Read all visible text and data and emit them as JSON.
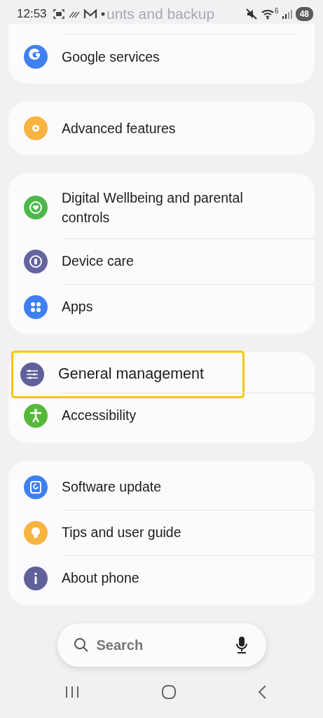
{
  "status_bar": {
    "time": "12:53",
    "wifi_band": "6",
    "battery": "48"
  },
  "faded_header": "unts and backup",
  "groups": [
    {
      "items": [
        {
          "label": "Google services",
          "color": "#3f7ff0",
          "highlighted": false
        }
      ]
    },
    {
      "items": [
        {
          "label": "Advanced features",
          "color": "#f7b43f",
          "highlighted": false
        }
      ]
    },
    {
      "items": [
        {
          "label": "Digital Wellbeing and parental controls",
          "color": "#4cb84a",
          "highlighted": false
        },
        {
          "label": "Device care",
          "color": "#6464a0",
          "highlighted": false
        },
        {
          "label": "Apps",
          "color": "#3f7ff0",
          "highlighted": false
        }
      ]
    },
    {
      "items": [
        {
          "label": "General management",
          "color": "#60609a",
          "highlighted": true
        },
        {
          "label": "Accessibility",
          "color": "#56b83a",
          "highlighted": false
        }
      ]
    },
    {
      "items": [
        {
          "label": "Software update",
          "color": "#3f7ff0",
          "highlighted": false
        },
        {
          "label": "Tips and user guide",
          "color": "#f7b43f",
          "highlighted": false
        },
        {
          "label": "About phone",
          "color": "#60609a",
          "highlighted": false
        }
      ]
    }
  ],
  "search": {
    "placeholder": "Search"
  }
}
